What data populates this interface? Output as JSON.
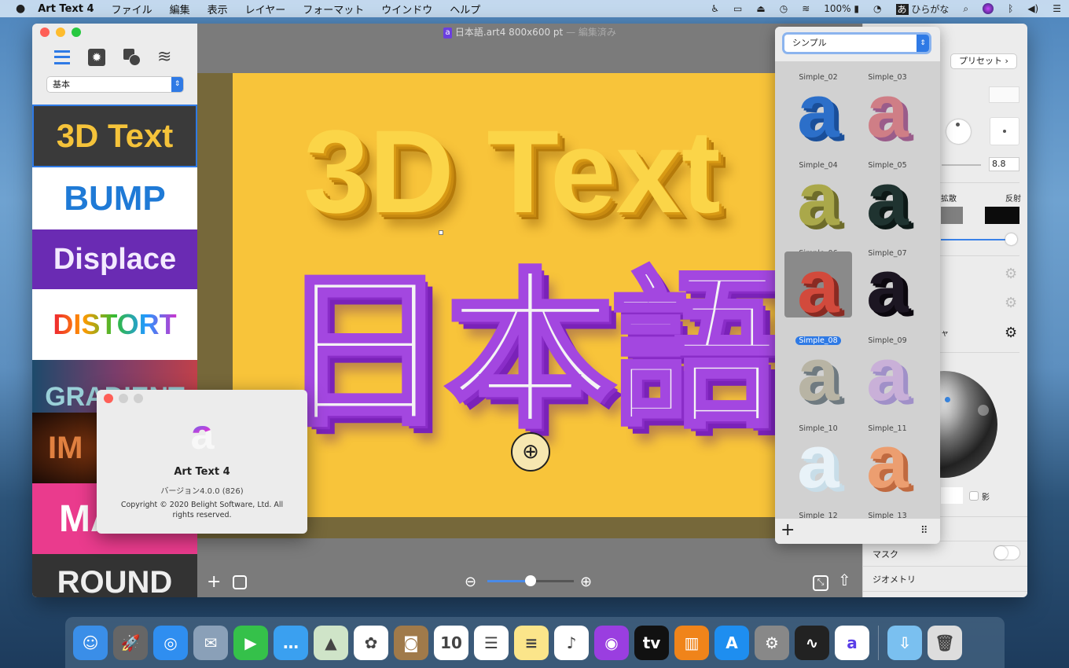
{
  "menubar": {
    "app": "Art Text 4",
    "items": [
      "ファイル",
      "編集",
      "表示",
      "レイヤー",
      "フォーマット",
      "ウインドウ",
      "ヘルプ"
    ],
    "battery": "100%",
    "input_method": "ひらがな",
    "input_badge": "あ"
  },
  "window": {
    "title": "日本語.art4 800x600 pt",
    "title_status": "— 編集済み"
  },
  "sidebar": {
    "category": "基本",
    "presets": [
      {
        "label": "3D Text"
      },
      {
        "label": "BUMP"
      },
      {
        "label": "Displace"
      },
      {
        "label": "DISTORT"
      },
      {
        "label": "GRADIENT"
      },
      {
        "label": "IM"
      },
      {
        "label": "MA"
      },
      {
        "label": "ROUND"
      }
    ]
  },
  "canvas": {
    "line1": "3D Text",
    "line2": "日本語"
  },
  "style_panel": {
    "category": "シンプル",
    "items": [
      "Simple_02",
      "Simple_03",
      "Simple_04",
      "Simple_05",
      "Simple_06",
      "Simple_07",
      "Simple_08",
      "Simple_09",
      "Simple_10",
      "Simple_11",
      "Simple_12",
      "Simple_13"
    ],
    "selected": "Simple_08"
  },
  "inspector": {
    "preset_button": "プリセット",
    "value": "8.8",
    "diffuse": "拡散",
    "reflect": "反射",
    "partial_label": "ャ",
    "shadow": "影",
    "mask": "マスク",
    "geometry": "ジオメトリ",
    "mask_on": false
  },
  "about": {
    "name": "Art Text 4",
    "version": "バージョン4.0.0 (826)",
    "copyright": "Copyright © 2020 Belight Software, Ltd. All rights reserved."
  },
  "colors": {
    "accent": "#2f7ae5",
    "artboard": "#f8c43a",
    "purple": "#9b3fd8"
  },
  "zoom_level": 0.45
}
